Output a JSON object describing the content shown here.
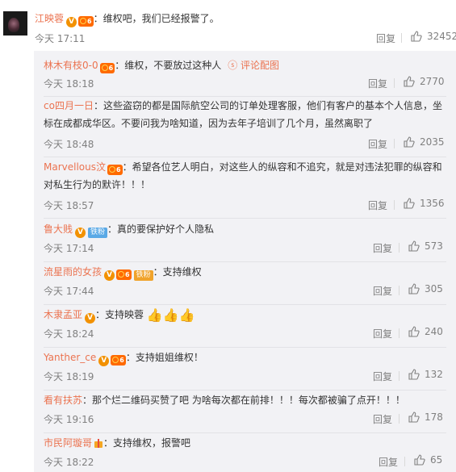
{
  "main_comment": {
    "username": "江映蓉",
    "colon": "：",
    "text": "维权吧，我们已经报警了。",
    "time": "今天 17:11",
    "reply": "回复",
    "likes": "32452"
  },
  "badges": {
    "v": "V",
    "fans": "铁粉",
    "gold_fans": "铁粉",
    "pic_link": "ⓢ 评论配图"
  },
  "replies": [
    {
      "username": "林木有枝0-0",
      "colon": "：",
      "text": "维权，不要放过这种人",
      "time": "今天 18:18",
      "reply": "回复",
      "likes": "2770"
    },
    {
      "username": "co四月一日",
      "colon": "：",
      "text": "这些盗窃的都是国际航空公司的订单处理客服，他们有客户的基本个人信息，坐标在成都成华区。不要问我为啥知道，因为去年子培训了几个月，虽然离职了",
      "time": "今天 18:48",
      "reply": "回复",
      "likes": "2035"
    },
    {
      "username": "Marvellous汶",
      "colon": "：",
      "text": "希望各位艺人明白，对这些人的纵容和不追究，就是对违法犯罪的纵容和对私生行为的默许！！！",
      "time": "今天 18:57",
      "reply": "回复",
      "likes": "1356"
    },
    {
      "username": "鲁大贱",
      "colon": "：",
      "text": "真的要保护好个人隐私",
      "time": "今天 17:14",
      "reply": "回复",
      "likes": "573"
    },
    {
      "username": "流星雨的女孩",
      "colon": "：",
      "text": "支持维权",
      "time": "今天 17:44",
      "reply": "回复",
      "likes": "305"
    },
    {
      "username": "木隶孟亚",
      "colon": "：",
      "text": "支持映蓉",
      "time": "今天 18:24",
      "reply": "回复",
      "likes": "240"
    },
    {
      "username": "Yanther_ce",
      "colon": "：",
      "text": "支持姐姐维权！",
      "time": "今天 18:19",
      "reply": "回复",
      "likes": "132"
    },
    {
      "username": "看有扶苏",
      "colon": "：",
      "text": "那个烂二维码买赞了吧 为啥每次都在前排！！！每次都被骗了点开！！！",
      "time": "今天 19:16",
      "reply": "回复",
      "likes": "178"
    },
    {
      "username": "市民阿璇哥",
      "colon": "：",
      "text": "支持维权，报警吧",
      "time": "今天 18:22",
      "reply": "回复",
      "likes": "65"
    }
  ],
  "colors": {
    "username": "#eb7350",
    "text": "#333333",
    "meta": "#808080",
    "panel": "#f2f2f5"
  },
  "icons": {
    "like": "thumbs-up-icon",
    "thumbs": "thumbs-up-emoji"
  }
}
